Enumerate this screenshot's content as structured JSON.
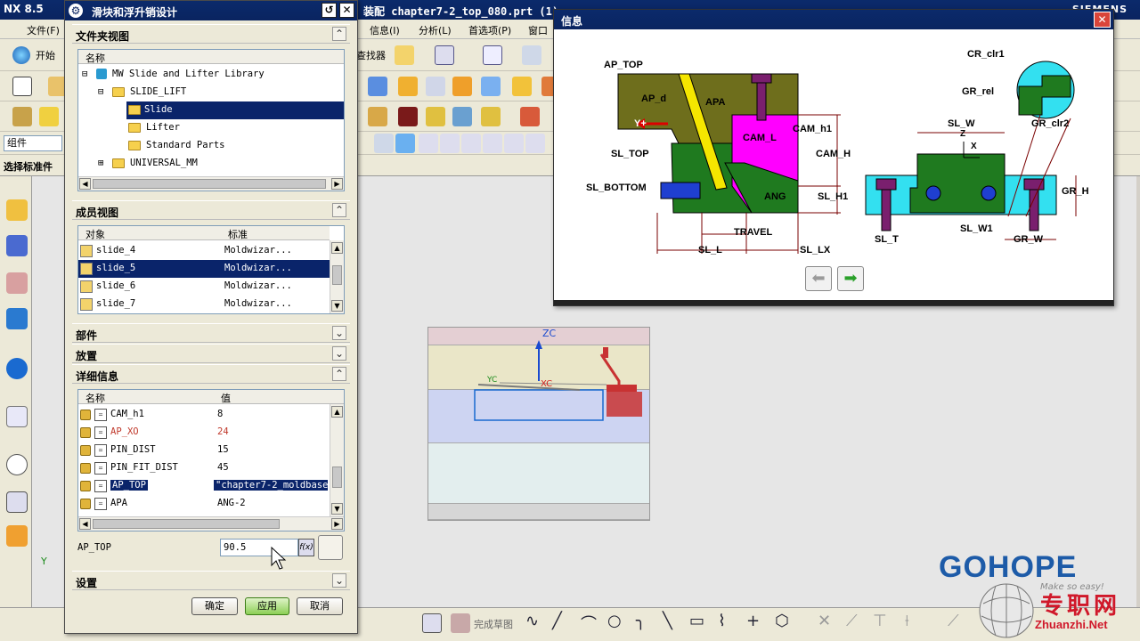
{
  "app": {
    "title_left": "NX 8.5",
    "file_title": "装配 chapter7-2_top_080.prt",
    "file_suffix": "(1)",
    "brand": "SIEMENS"
  },
  "menubar": {
    "file": "文件(F)",
    "start": "开始",
    "info": "信息(I)",
    "analysis": "分析(L)",
    "prefs": "首选项(P)",
    "window": "窗口",
    "finder": "查找器"
  },
  "toolbar": {
    "component_label": "组件",
    "select_std_part": "选择标准件"
  },
  "bottom_toolbar": {
    "finish_sketch": "完成草图"
  },
  "dialog": {
    "title": "滑块和浮升销设计",
    "sections": {
      "folder_view": "文件夹视图",
      "member_view": "成员视图",
      "part": "部件",
      "placement": "放置",
      "details": "详细信息",
      "settings": "设置"
    },
    "folder_tree": {
      "header": "名称",
      "items": [
        {
          "label": "MW Slide and Lifter Library"
        },
        {
          "label": "SLIDE_LIFT"
        },
        {
          "label": "Slide"
        },
        {
          "label": "Lifter"
        },
        {
          "label": "Standard Parts"
        },
        {
          "label": "UNIVERSAL_MM"
        }
      ]
    },
    "member_list": {
      "headers": [
        "对象",
        "标准"
      ],
      "rows": [
        {
          "name": "slide_4",
          "std": "Moldwizar..."
        },
        {
          "name": "slide_5",
          "std": "Moldwizar..."
        },
        {
          "name": "slide_6",
          "std": "Moldwizar..."
        },
        {
          "name": "slide_7",
          "std": "Moldwizar..."
        }
      ]
    },
    "details_list": {
      "headers": [
        "名称",
        "值"
      ],
      "rows": [
        {
          "name": "CAM_h1",
          "value": "8"
        },
        {
          "name": "AP_XO",
          "value": "24"
        },
        {
          "name": "PIN_DIST",
          "value": "15"
        },
        {
          "name": "PIN_FIT_DIST",
          "value": "45"
        },
        {
          "name": "AP_TOP",
          "value": "\"chapter7-2_moldbase"
        },
        {
          "name": "APA",
          "value": "ANG-2"
        }
      ]
    },
    "edit": {
      "label": "AP_TOP",
      "value": "90.5"
    },
    "buttons": {
      "ok": "确定",
      "apply": "应用",
      "cancel": "取消"
    }
  },
  "info_window": {
    "title": "信息",
    "labels": {
      "ap_top": "AP_TOP",
      "ap_d": "AP_d",
      "apa": "APA",
      "y_plus": "Y+",
      "cam_l": "CAM_L",
      "cam_h1": "CAM_h1",
      "cam_h": "CAM_H",
      "sl_top": "SL_TOP",
      "sl_bottom": "SL_BOTTOM",
      "ang": "ANG",
      "sl_h1": "SL_H1",
      "travel": "TRAVEL",
      "sl_l": "SL_L",
      "sl_lx": "SL_LX",
      "cr_clr1": "CR_clr1",
      "gr_rel": "GR_rel",
      "gr_clr2": "GR_clr2",
      "sl_w": "SL_W",
      "z": "Z",
      "x": "X",
      "gr_h": "GR_H",
      "sl_t": "SL_T",
      "sl_w1": "SL_W1",
      "gr_w": "GR_W"
    }
  },
  "viewport": {
    "zc": "ZC",
    "xc": "XC",
    "yc": "YC",
    "y_axis": "Y"
  },
  "watermark": {
    "brand": "GOHOPE",
    "cn": "专职网",
    "site": "Zhuanzhi.Net",
    "tagline": "Make so easy!"
  },
  "colors": {
    "olive": "#6e6e1c",
    "green": "#1f7a1f",
    "magenta": "#ff00ff",
    "cyan": "#33e0f0",
    "purple": "#7a1f6e",
    "dim": "#7a0000"
  }
}
